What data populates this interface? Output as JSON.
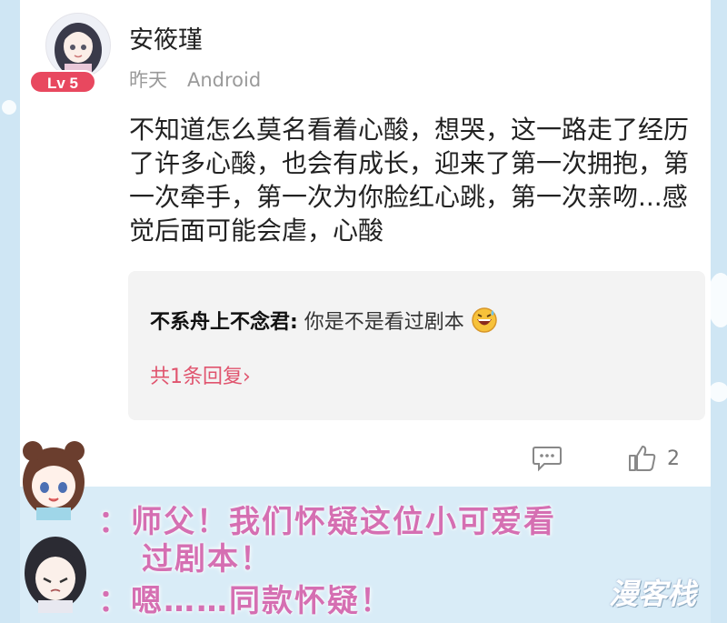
{
  "comment": {
    "username": "安筱瑾",
    "level_badge": "Lv 5",
    "meta": {
      "time": "昨天",
      "device": "Android"
    },
    "text": "不知道怎么莫名看着心酸，想哭，这一路走了经历了许多心酸，也会有成长，迎来了第一次拥抱，第一次牵手，第一次为你脸红心跳，第一次亲吻...感觉后面可能会虐，心酸",
    "reply": {
      "author": "不系舟上不念君:",
      "text": " 你是不是看过剧本",
      "emoji": "grinning-sweat-icon",
      "count_label": "共1条回复",
      "chevron": "›"
    },
    "like_count": "2"
  },
  "captions": {
    "line1a": "：师父！我们怀疑这位小可爱看",
    "line1b": "过剧本！",
    "line2": "：嗯……同款怀疑！"
  },
  "watermark": "漫客栈",
  "colors": {
    "badge": "#e8485f",
    "reply_link": "#e0546e",
    "caption": "#d56fb2",
    "bg": "#d9ecf7"
  }
}
